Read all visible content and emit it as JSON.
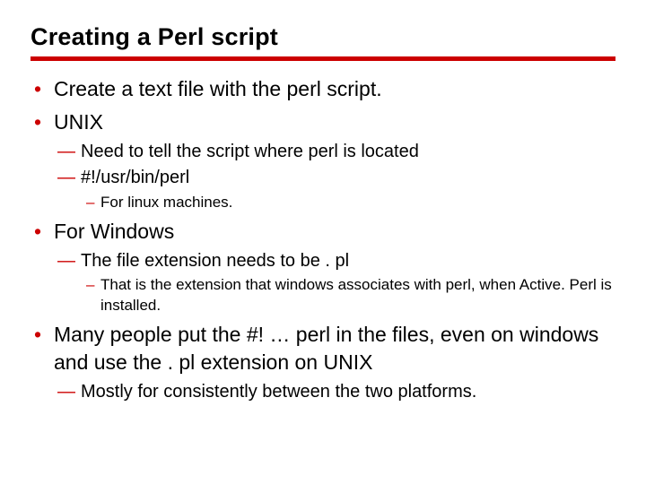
{
  "title": "Creating a Perl script",
  "b1": {
    "text": "Create a text file with the perl script."
  },
  "b2": {
    "text": "UNIX",
    "s1": "Need to tell the script where perl is located",
    "s2": "#!/usr/bin/perl",
    "s2a": "For linux machines."
  },
  "b3": {
    "text": "For Windows",
    "s1": "The file extension needs to be . pl",
    "s1a": "That is the extension that windows associates with perl, when Active. Perl is installed."
  },
  "b4": {
    "text": "Many people put the #! … perl in the files, even on windows and use the . pl extension on UNIX",
    "s1": "Mostly for consistently between the two platforms."
  }
}
